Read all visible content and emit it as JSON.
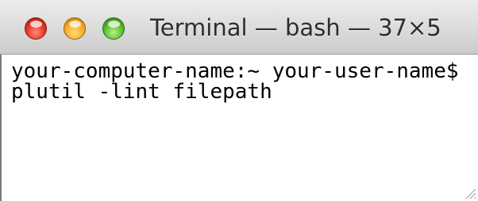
{
  "window": {
    "title": "Terminal — bash — 37×5"
  },
  "terminal": {
    "prompt_line": "your-computer-name:~ your-user-name$",
    "command_line": "plutil -lint filepath"
  },
  "colors": {
    "close": "#e0301e",
    "minimize": "#f5a623",
    "zoom": "#52b82a",
    "text": "#000000",
    "background": "#ffffff"
  },
  "icons": {
    "close": "close-icon",
    "minimize": "minimize-icon",
    "zoom": "zoom-icon",
    "resize": "resize-grip-icon"
  }
}
